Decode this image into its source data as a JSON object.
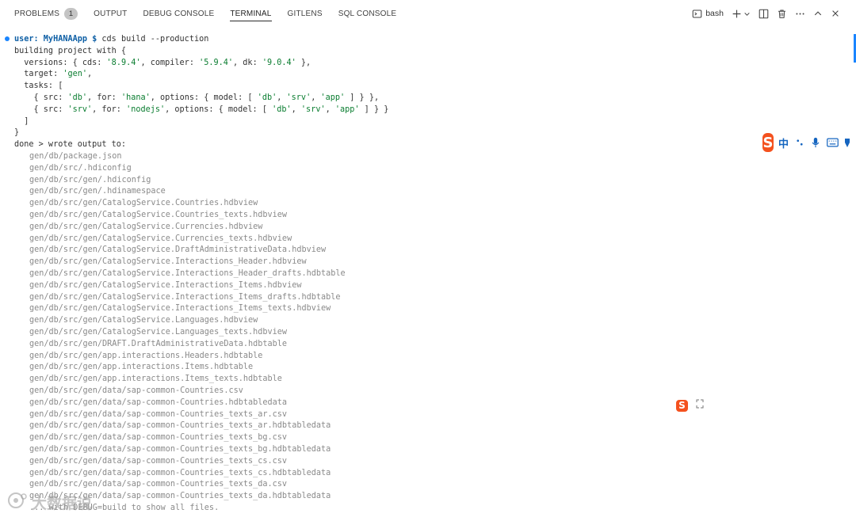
{
  "panel": {
    "tabs": [
      {
        "label": "PROBLEMS",
        "badge": "1"
      },
      {
        "label": "OUTPUT"
      },
      {
        "label": "DEBUG CONSOLE"
      },
      {
        "label": "TERMINAL",
        "active": true
      },
      {
        "label": "GITLENS"
      },
      {
        "label": "SQL CONSOLE"
      }
    ],
    "shell": "bash"
  },
  "terminal": {
    "prompt_user": "user: MyHANAApp $",
    "command": " cds build --production",
    "lines": [
      "building project with {",
      "  versions: { cds: '8.9.4', compiler: '5.9.4', dk: '9.0.4' },",
      "  target: 'gen',",
      "  tasks: [",
      "    { src: 'db', for: 'hana', options: { model: [ 'db', 'srv', 'app' ] } },",
      "    { src: 'srv', for: 'nodejs', options: { model: [ 'db', 'srv', 'app' ] } }",
      "  ]",
      "}",
      "done > wrote output to:"
    ],
    "files": [
      "gen/db/package.json",
      "gen/db/src/.hdiconfig",
      "gen/db/src/gen/.hdiconfig",
      "gen/db/src/gen/.hdinamespace",
      "gen/db/src/gen/CatalogService.Countries.hdbview",
      "gen/db/src/gen/CatalogService.Countries_texts.hdbview",
      "gen/db/src/gen/CatalogService.Currencies.hdbview",
      "gen/db/src/gen/CatalogService.Currencies_texts.hdbview",
      "gen/db/src/gen/CatalogService.DraftAdministrativeData.hdbview",
      "gen/db/src/gen/CatalogService.Interactions_Header.hdbview",
      "gen/db/src/gen/CatalogService.Interactions_Header_drafts.hdbtable",
      "gen/db/src/gen/CatalogService.Interactions_Items.hdbview",
      "gen/db/src/gen/CatalogService.Interactions_Items_drafts.hdbtable",
      "gen/db/src/gen/CatalogService.Interactions_Items_texts.hdbview",
      "gen/db/src/gen/CatalogService.Languages.hdbview",
      "gen/db/src/gen/CatalogService.Languages_texts.hdbview",
      "gen/db/src/gen/DRAFT.DraftAdministrativeData.hdbtable",
      "gen/db/src/gen/app.interactions.Headers.hdbtable",
      "gen/db/src/gen/app.interactions.Items.hdbtable",
      "gen/db/src/gen/app.interactions.Items_texts.hdbtable",
      "gen/db/src/gen/data/sap-common-Countries.csv",
      "gen/db/src/gen/data/sap-common-Countries.hdbtabledata",
      "gen/db/src/gen/data/sap-common-Countries_texts_ar.csv",
      "gen/db/src/gen/data/sap-common-Countries_texts_ar.hdbtabledata",
      "gen/db/src/gen/data/sap-common-Countries_texts_bg.csv",
      "gen/db/src/gen/data/sap-common-Countries_texts_bg.hdbtabledata",
      "gen/db/src/gen/data/sap-common-Countries_texts_cs.csv",
      "gen/db/src/gen/data/sap-common-Countries_texts_cs.hdbtabledata",
      "gen/db/src/gen/data/sap-common-Countries_texts_da.csv",
      "gen/db/src/gen/data/sap-common-Countries_texts_da.hdbtabledata",
      "... with DEBUG=build to show all files."
    ]
  },
  "ime": {
    "mode": "中",
    "logo": "S"
  },
  "watermark": "大数据说"
}
